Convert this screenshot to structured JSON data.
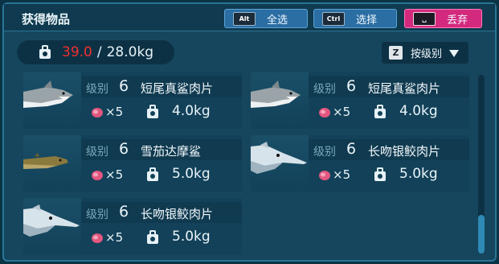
{
  "header": {
    "title": "获得物品",
    "buttons": [
      {
        "key": "Alt",
        "label": "全选"
      },
      {
        "key": "Ctrl",
        "label": "选择"
      },
      {
        "key": "␣",
        "label": "丢弃"
      }
    ]
  },
  "weight": {
    "current": "39.0",
    "separator": "/",
    "max": "28.0kg"
  },
  "sort": {
    "key": "Z",
    "label": "按级别"
  },
  "level_label": "级别",
  "items": [
    {
      "name": "短尾真鲨肉片",
      "level": "6",
      "qty": "×5",
      "weight": "4.0kg",
      "fish": "shark"
    },
    {
      "name": "短尾真鲨肉片",
      "level": "6",
      "qty": "×5",
      "weight": "4.0kg",
      "fish": "shark"
    },
    {
      "name": "雪茄达摩鲨",
      "level": "6",
      "qty": "×5",
      "weight": "5.0kg",
      "fish": "cigar-shark"
    },
    {
      "name": "长吻银鲛肉片",
      "level": "6",
      "qty": "×5",
      "weight": "5.0kg",
      "fish": "chimaera"
    },
    {
      "name": "长吻银鲛肉片",
      "level": "6",
      "qty": "×5",
      "weight": "5.0kg",
      "fish": "chimaera"
    }
  ],
  "colors": {
    "overweight": "#f0312f",
    "discard": "#d42a7e",
    "accent": "#2b6ea3"
  },
  "scroll": {
    "fraction": 0.78
  }
}
